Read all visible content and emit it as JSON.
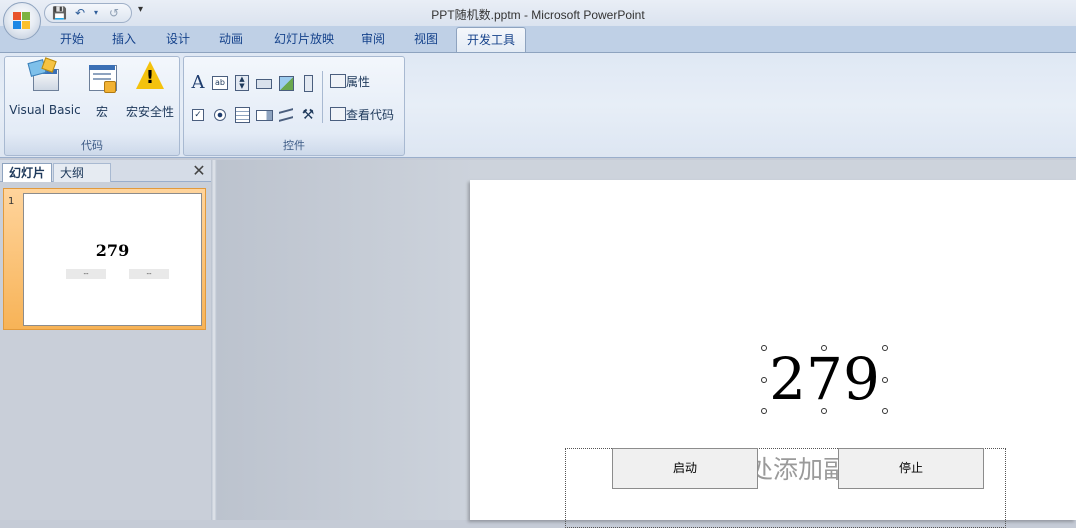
{
  "window": {
    "title": "PPT随机数.pptm - Microsoft PowerPoint"
  },
  "quick_access": {
    "icons": [
      "save-icon",
      "undo-icon",
      "redo-icon",
      "customize-dropdown-icon"
    ]
  },
  "tabs": [
    {
      "label": "开始"
    },
    {
      "label": "插入"
    },
    {
      "label": "设计"
    },
    {
      "label": "动画"
    },
    {
      "label": "幻灯片放映"
    },
    {
      "label": "审阅"
    },
    {
      "label": "视图"
    },
    {
      "label": "开发工具",
      "active": true
    }
  ],
  "ribbon": {
    "code_group": {
      "label": "代码",
      "buttons": [
        {
          "label": "Visual Basic",
          "icon": "visual-basic-icon"
        },
        {
          "label": "宏",
          "icon": "macros-icon"
        },
        {
          "label": "宏安全性",
          "icon": "macro-security-warning-icon"
        }
      ]
    },
    "controls_group": {
      "label": "控件",
      "properties_label": "属性",
      "view_code_label": "查看代码"
    }
  },
  "left_pane": {
    "tabs": [
      {
        "label": "幻灯片",
        "active": true
      },
      {
        "label": "大纲"
      }
    ],
    "slide_number": "1",
    "thumb_value": "279",
    "thumb_buttons": [
      "--",
      "--"
    ]
  },
  "slide": {
    "number": "279",
    "placeholder_text": "处添加副",
    "start_button": "启动",
    "stop_button": "停止"
  },
  "colors": {
    "tab_text": "#15428b",
    "ribbon_bg": "#dfe8f4",
    "selected_thumb": "#f7b357"
  }
}
